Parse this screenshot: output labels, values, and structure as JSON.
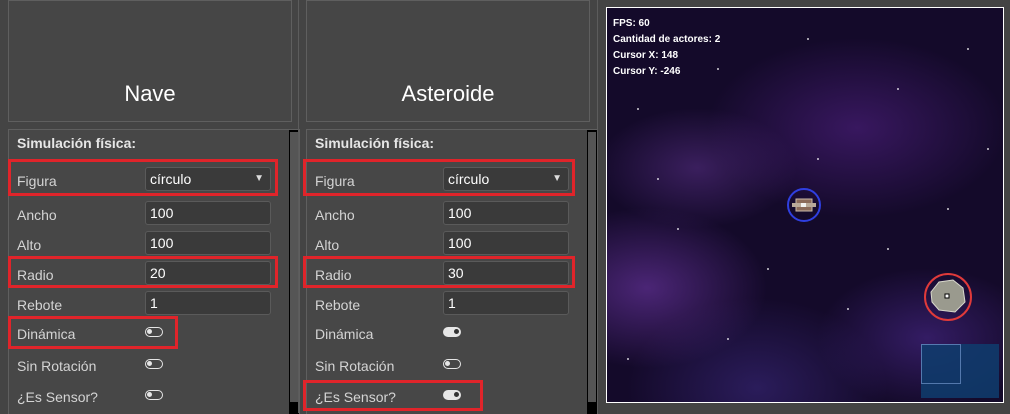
{
  "left_panel": {
    "title": "Nave",
    "section": "Simulación física:",
    "figura_label": "Figura",
    "figura_value": "círculo",
    "ancho_label": "Ancho",
    "ancho_value": "100",
    "alto_label": "Alto",
    "alto_value": "100",
    "radio_label": "Radio",
    "radio_value": "20",
    "rebote_label": "Rebote",
    "rebote_value": "1",
    "dinamica_label": "Dinámica",
    "dinamica_on": false,
    "sin_rotacion_label": "Sin Rotación",
    "sin_rotacion_on": false,
    "sensor_label": "¿Es Sensor?",
    "sensor_on": false
  },
  "right_panel": {
    "title": "Asteroide",
    "section": "Simulación física:",
    "figura_label": "Figura",
    "figura_value": "círculo",
    "ancho_label": "Ancho",
    "ancho_value": "100",
    "alto_label": "Alto",
    "alto_value": "100",
    "radio_label": "Radio",
    "radio_value": "30",
    "rebote_label": "Rebote",
    "rebote_value": "1",
    "dinamica_label": "Dinámica",
    "dinamica_on": true,
    "sin_rotacion_label": "Sin Rotación",
    "sin_rotacion_on": false,
    "sensor_label": "¿Es Sensor?",
    "sensor_on": true
  },
  "game": {
    "fps": "FPS: 60",
    "actors": "Cantidad de actores: 2",
    "cursor_x": "Cursor X: 148",
    "cursor_y": "Cursor Y: -246"
  },
  "colors": {
    "highlight": "#e0242a",
    "ship_circle": "#2f3fe0",
    "asteroid_circle": "#e03a3a"
  }
}
